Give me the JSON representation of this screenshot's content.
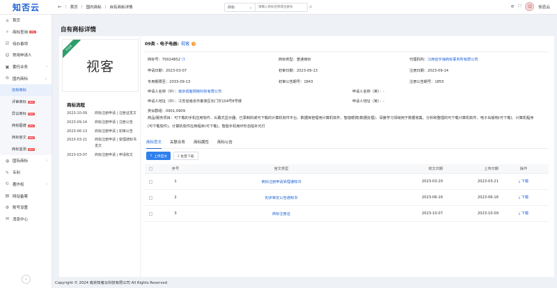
{
  "brand": {
    "logo": "知否云"
  },
  "topbar": {
    "breadcrumbs": [
      "首页",
      "国内商标",
      "自有商标详情"
    ],
    "search": {
      "select_value": "商标",
      "placeholder": "请输入商标名称或注册号"
    },
    "user_name": "知否云"
  },
  "sidebar": {
    "items": [
      {
        "label": "首页",
        "icon": "home-icon",
        "badge": ""
      },
      {
        "label": "商标查询",
        "icon": "search-icon",
        "badge": "NEW"
      },
      {
        "label": "待办事项",
        "icon": "todo-icon",
        "badge": ""
      },
      {
        "label": "常用申请人",
        "icon": "user-icon",
        "badge": ""
      },
      {
        "label": "委托业务",
        "icon": "briefcase-icon",
        "badge": "",
        "chevron": "›"
      },
      {
        "label": "国内商标",
        "icon": "trademark-icon",
        "badge": "",
        "chevron": "⌄"
      }
    ],
    "subitems": [
      {
        "label": "自有商标",
        "badge": "",
        "active": true
      },
      {
        "label": "评审商标",
        "badge": "NEW",
        "active": false
      },
      {
        "label": "异议商标",
        "badge": "NEW",
        "active": false
      },
      {
        "label": "商标图谱",
        "badge": "NEW",
        "active": false
      },
      {
        "label": "商标官文",
        "badge": "NEW",
        "active": false
      },
      {
        "label": "商标监测",
        "badge": "NEW",
        "active": false
      }
    ],
    "items_after": [
      {
        "label": "国际商标",
        "icon": "globe-icon",
        "badge": "",
        "chevron": "›"
      },
      {
        "label": "专利",
        "icon": "patent-icon",
        "badge": ""
      },
      {
        "label": "著作权",
        "icon": "copyright-icon",
        "badge": "",
        "chevron": "›"
      },
      {
        "label": "网站备案",
        "icon": "website-icon",
        "badge": ""
      },
      {
        "label": "账号设置",
        "icon": "account-icon",
        "badge": ""
      },
      {
        "label": "消息中心",
        "icon": "message-icon",
        "badge": ""
      }
    ]
  },
  "page": {
    "title": "自有商标详情"
  },
  "mark": {
    "image_text": "视客",
    "status_ribbon": "已注册",
    "class_label": "09类 - 电子电器:",
    "name": "视客",
    "info_icon": "i",
    "fields": {
      "reg_no_label": "商标号：",
      "reg_no": "70024852",
      "type_label": "商标类型：",
      "type": "普通商标",
      "agent_label": "代理机构：",
      "agent": "江西省宇海商标事务所有限公司",
      "apply_date_label": "申请日期：",
      "apply_date": "2023-03-07",
      "prelim_date_label": "初审日期：",
      "prelim_date": "2023-06-13",
      "reg_date_label": "注册日期：",
      "reg_date": "2023-09-14",
      "expire_label": "专用期限至：",
      "expire": "2033-09-13",
      "prelim_no_label": "初审公告期号：",
      "prelim_no": "1843",
      "reg_no_pub_label": "注册公告期号：",
      "reg_no_pub": "1855",
      "applicant_cn_label": "申请人名称（中）：",
      "applicant_cn": "南京视客网络科技有限公司",
      "applicant_en_label": "申请人名称（英）：",
      "applicant_en": "-",
      "address_cn_label": "申请人地址（中）：",
      "address_cn": "江苏省南京市秦淮区石门坎104号8号楼",
      "address_en_label": "申请人地址（英）：",
      "address_en": "-",
      "subgroup_label": "类似群组：",
      "subgroup": "0901,0909",
      "goods_label": "商品/服务项目：",
      "goods": "可下载的手机应用软件、头戴式显示器、已录制的或可下载的计算机软件平台、数据库管理用计算机软件、智能眼镜(数据处理)、深度学习领域用于数据收集、分析和整理的可下载计算机软件、电子出版物(可下载)、计算机程序(可下载软件)、计算机软件应用程序(可下载)、智能手机用环形自拍补光灯"
    }
  },
  "flow": {
    "title": "商标流程",
    "rows": [
      {
        "date": "2023-10-09",
        "desc": "商标注册申请 | 注册证发文"
      },
      {
        "date": "2023-09-14",
        "desc": "商标注册申请 | 注册公告"
      },
      {
        "date": "2023-06-13",
        "desc": "商标注册申请 | 初审公告"
      },
      {
        "date": "2023-03-21",
        "desc": "商标注册申请 | 受理通知书发文"
      },
      {
        "date": "2023-03-07",
        "desc": "商标注册申请 | 申请收文"
      }
    ]
  },
  "tabs": [
    "商标官文",
    "关联业务",
    "商标属性",
    "商标公告"
  ],
  "buttons": {
    "upload": "上传官文",
    "batch_download": "批量下载"
  },
  "table": {
    "headers": {
      "no": "序号",
      "type": "官文类型",
      "recv_date": "收文日期",
      "upload_date": "上传日期",
      "op": "操作"
    },
    "rows": [
      {
        "no": "1",
        "type": "商标注册申请受理通知书",
        "recv_date": "2023-03-20",
        "upload_date": "2023-03-21",
        "op": "下载"
      },
      {
        "no": "2",
        "type": "初步审定公告通知书",
        "recv_date": "2023-06-16",
        "upload_date": "2023-06-16",
        "op": "下载"
      },
      {
        "no": "3",
        "type": "商标注册证",
        "recv_date": "2023-10-07",
        "upload_date": "2023-10-09",
        "op": "下载"
      }
    ]
  },
  "footer": "Copyright © 2024 南京知者云科技有限公司 All Rights Reserved",
  "colors": {
    "primary": "#1a5fd6",
    "ribbon": "#2e9e6c",
    "badge": "#f04b4b"
  }
}
